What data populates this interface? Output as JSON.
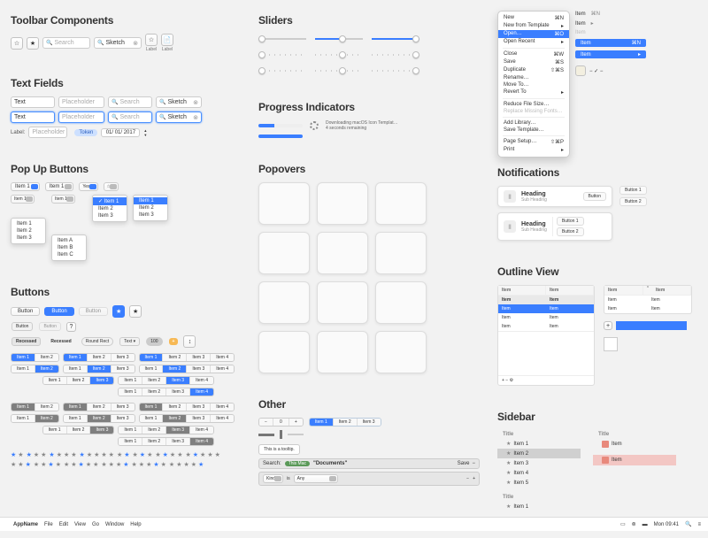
{
  "sections": {
    "toolbar": "Toolbar Components",
    "textfields": "Text Fields",
    "popup": "Pop Up Buttons",
    "buttons": "Buttons",
    "sliders": "Sliders",
    "progress": "Progress Indicators",
    "popovers": "Popovers",
    "other": "Other",
    "notifications": "Notifications",
    "outline": "Outline View",
    "sidebar": "Sidebar"
  },
  "toolbar": {
    "label": "Label",
    "search_placeholder": "Search",
    "search_typed": "Sketch"
  },
  "textfields": {
    "text": "Text",
    "placeholder": "Placeholder",
    "search": "Search",
    "typed": "Sketch",
    "label": "Label:",
    "token": "Token",
    "date": "01/ 01/ 2017"
  },
  "popup": {
    "item1": "Item 1",
    "yes": "Yes",
    "menu_a": [
      "Item 1",
      "Item 2",
      "Item 3"
    ],
    "menu_b": [
      "Item A",
      "Item B",
      "Item C"
    ]
  },
  "buttons": {
    "button": "Button",
    "recessed": "Recessed",
    "roundrect": "Round Rect",
    "text": "Text",
    "hundred": "100",
    "plus": "+",
    "seg_items": [
      "Item 1",
      "Item 2",
      "Item 3",
      "Item 4"
    ]
  },
  "progress": {
    "downloading": "Downloading macOS Icon Templat…",
    "remaining": "4 seconds remaining"
  },
  "other": {
    "seg": [
      "Item 1",
      "Item 2",
      "Item 3"
    ],
    "tooltip": "This is a tooltip.",
    "search_label": "Search:",
    "thismac": "This Mac",
    "docs": "\"Documents\"",
    "save": "Save",
    "kind": "Kind",
    "is": "is",
    "any": "Any"
  },
  "ctxmenu": {
    "items": [
      {
        "l": "New",
        "s": "⌘N"
      },
      {
        "l": "New from Template",
        "s": "▸"
      },
      {
        "l": "Open…",
        "s": "⌘O",
        "sel": true
      },
      {
        "l": "Open Recent",
        "s": "▸"
      },
      "sep",
      {
        "l": "Close",
        "s": "⌘W"
      },
      {
        "l": "Save",
        "s": "⌘S"
      },
      {
        "l": "Duplicate",
        "s": "⇧⌘S"
      },
      {
        "l": "Rename…",
        "s": ""
      },
      {
        "l": "Move To…",
        "s": ""
      },
      {
        "l": "Revert To",
        "s": "▸"
      },
      "sep",
      {
        "l": "Reduce File Size…",
        "s": ""
      },
      {
        "l": "Replace Missing Fonts…",
        "s": "",
        "dim": true
      },
      "sep",
      {
        "l": "Add Library…",
        "s": ""
      },
      {
        "l": "Save Template…",
        "s": ""
      },
      "sep",
      {
        "l": "Page Setup…",
        "s": "⇧⌘P"
      },
      {
        "l": "Print",
        "s": "▸"
      }
    ]
  },
  "ctxlist": {
    "item": "Item",
    "short": "⌘N"
  },
  "notifications": {
    "heading": "Heading",
    "sub": "Sub Heading",
    "button": "Button",
    "button1": "Button 1",
    "button2": "Button 2"
  },
  "outline": {
    "item": "Item"
  },
  "sidebar": {
    "title": "Title",
    "items": [
      "Item 1",
      "Item 2",
      "Item 3",
      "Item 4",
      "Item 5"
    ],
    "item": "Item"
  },
  "menubar": {
    "app": "AppName",
    "items": [
      "File",
      "Edit",
      "View",
      "Go",
      "Window",
      "Help"
    ],
    "time": "Mon 09:41"
  }
}
